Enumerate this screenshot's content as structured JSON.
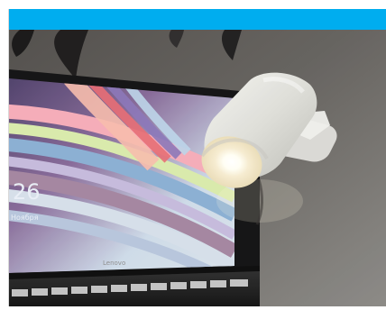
{
  "window": {
    "title_bar_color": "#00adef"
  },
  "photo": {
    "visible_text": {
      "screen_clock": "26",
      "screen_date": "Ноября",
      "laptop_brand": "Lenovo"
    },
    "colors": {
      "wall": "#5f5d5a",
      "lamp_body": "#e7e7e2",
      "bulb_glow": "#fffef4",
      "screen_frame": "#111111"
    }
  }
}
